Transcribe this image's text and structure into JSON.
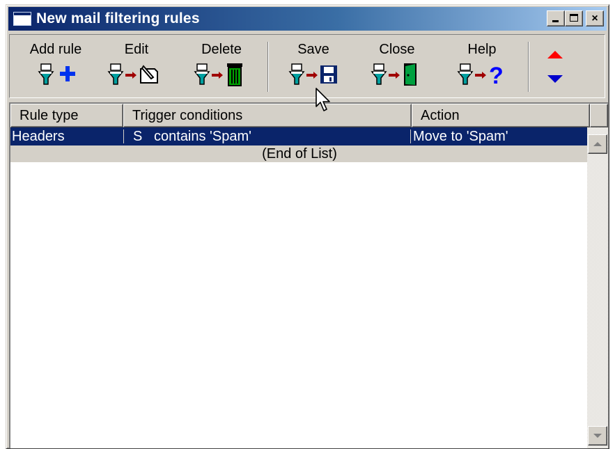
{
  "window": {
    "title": "New mail filtering rules",
    "icon": "mail-window-icon"
  },
  "caption_buttons": [
    {
      "name": "minimize",
      "icon": "minimize-icon"
    },
    {
      "name": "maximize",
      "icon": "maximize-icon"
    },
    {
      "name": "close",
      "label": "×",
      "icon": "close-icon"
    }
  ],
  "toolbar": {
    "buttons": [
      {
        "label": "Add rule",
        "icon": "filter-plus-icon"
      },
      {
        "label": "Edit",
        "icon": "filter-edit-icon"
      },
      {
        "label": "Delete",
        "icon": "filter-trash-icon"
      },
      {
        "label": "Save",
        "icon": "filter-floppy-icon"
      },
      {
        "label": "Close",
        "icon": "filter-door-icon"
      },
      {
        "label": "Help",
        "icon": "filter-help-icon"
      }
    ],
    "move_up_icon": "red-up-arrow-icon",
    "move_down_icon": "blue-down-arrow-icon",
    "colors": {
      "up": "#ff0000",
      "down": "#0000cc",
      "plus": "#0033ee",
      "trash": "#008000",
      "floppy": "#0a246a",
      "help": "#0000ff"
    }
  },
  "list": {
    "columns": [
      "Rule type",
      "Trigger conditions",
      "Action"
    ],
    "rows": [
      {
        "rule_type": "Headers",
        "trigger": "S   contains 'Spam'",
        "action": "Move to 'Spam'",
        "selected": true
      }
    ],
    "end_marker": "(End of List)"
  },
  "colors": {
    "selection": "#0a246a",
    "face": "#d4d0c8",
    "title_gradient_start": "#0a246a",
    "title_gradient_end": "#a6caf0"
  }
}
